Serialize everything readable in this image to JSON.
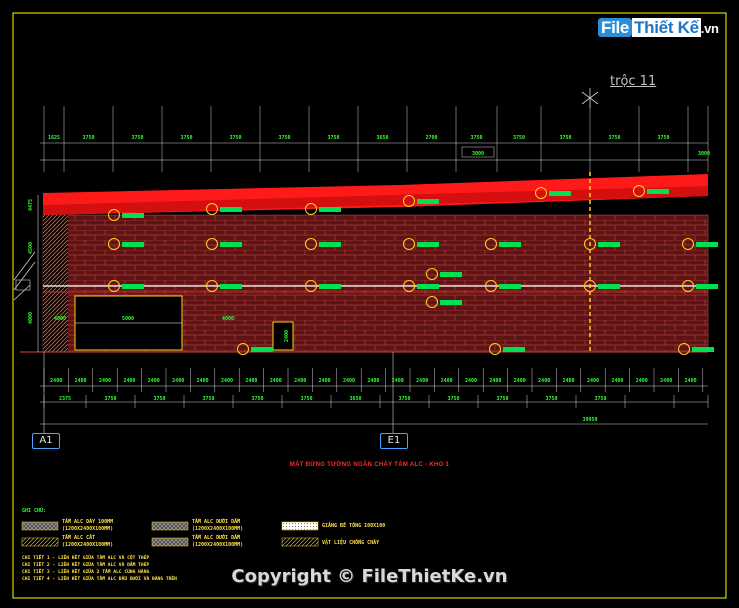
{
  "logo": {
    "part1": "File",
    "part2": "Thiết Kế",
    "part3": ".vn"
  },
  "axis_label": "trộc 11",
  "grid_tags": [
    "A1",
    "E1"
  ],
  "drawing_title": "MẶT ĐỨNG TƯỜNG NGĂN CHÁY TẤM ALC - KHO 1",
  "copyright": "Copyright © FileThietKe.vn",
  "top_dims": {
    "row1": [
      "1625",
      "3750",
      "3750",
      "3750",
      "3750",
      "3750",
      "3750",
      "3650",
      "2700",
      "3750",
      "3750",
      "3750",
      "3750",
      "3750"
    ],
    "row2": [
      "3000",
      "3000"
    ]
  },
  "bottom_dims": {
    "row1": [
      "2400",
      "2400",
      "2400",
      "2400",
      "2400",
      "2400",
      "2400",
      "2400",
      "2400",
      "2400",
      "2400",
      "2400",
      "2400",
      "2400",
      "2400",
      "2400",
      "2400",
      "2400",
      "2400",
      "2400",
      "2400",
      "2400",
      "2400",
      "2400",
      "2400",
      "2400",
      "2400"
    ],
    "row2": [
      "2375",
      "3750",
      "3750",
      "3750",
      "3750",
      "3750",
      "3650",
      "3750",
      "3750",
      "3750",
      "3750",
      "3750"
    ],
    "total": "39950"
  },
  "side_dims": [
    "4475",
    "4500",
    "4000"
  ],
  "door_dims": {
    "width": "5000",
    "height": "4000",
    "small_w": "4000",
    "small_h": "2400"
  },
  "legend": {
    "heading": "GHI CHÚ:",
    "items": [
      {
        "label": "TẤM ALC DÀY 100MM",
        "sub": "(1200X2400X100MM)"
      },
      {
        "label": "TẤM ALC CẮT",
        "sub": "(1200X2400X100MM)"
      },
      {
        "label": "TẤM ALC DƯỚI DẦM",
        "sub": "(1200X2400X100MM)"
      },
      {
        "label": "TẤM ALC DƯỚI DẦM",
        "sub": "(1200X2400X100MM)"
      },
      {
        "label": "GIẰNG BÊ TÔNG 100X100",
        "sub": ""
      },
      {
        "label": "VẬT LIỆU CHỐNG CHÁY",
        "sub": ""
      }
    ],
    "notes": [
      "CHI TIẾT 1 - LIÊN KẾT GIỮA TẤM ALC VÀ CỘT THÉP",
      "CHI TIẾT 2 - LIÊN KẾT GIỮA TẤM ALC VÀ DẦM THÉP",
      "CHI TIẾT 3 - LIÊN KẾT GIỮA 2 TẤM ALC CÙNG HÀNG",
      "CHI TIẾT 4 - LIÊN KẾT GIỮA TẤM ALC ĐẦU DƯỚI VÀ ĐÁNG TRÊN"
    ]
  },
  "colors": {
    "background": "#000000",
    "frame": "#ffff00",
    "roof": "#ff1a1a",
    "wall": "#6b1a1a",
    "brick_line": "#b04040",
    "dim_text": "#33ff33",
    "dim_line": "#d0d0d0",
    "marker": "#ffd21a",
    "tag": "#00ff55",
    "beam": "#ffffff"
  }
}
